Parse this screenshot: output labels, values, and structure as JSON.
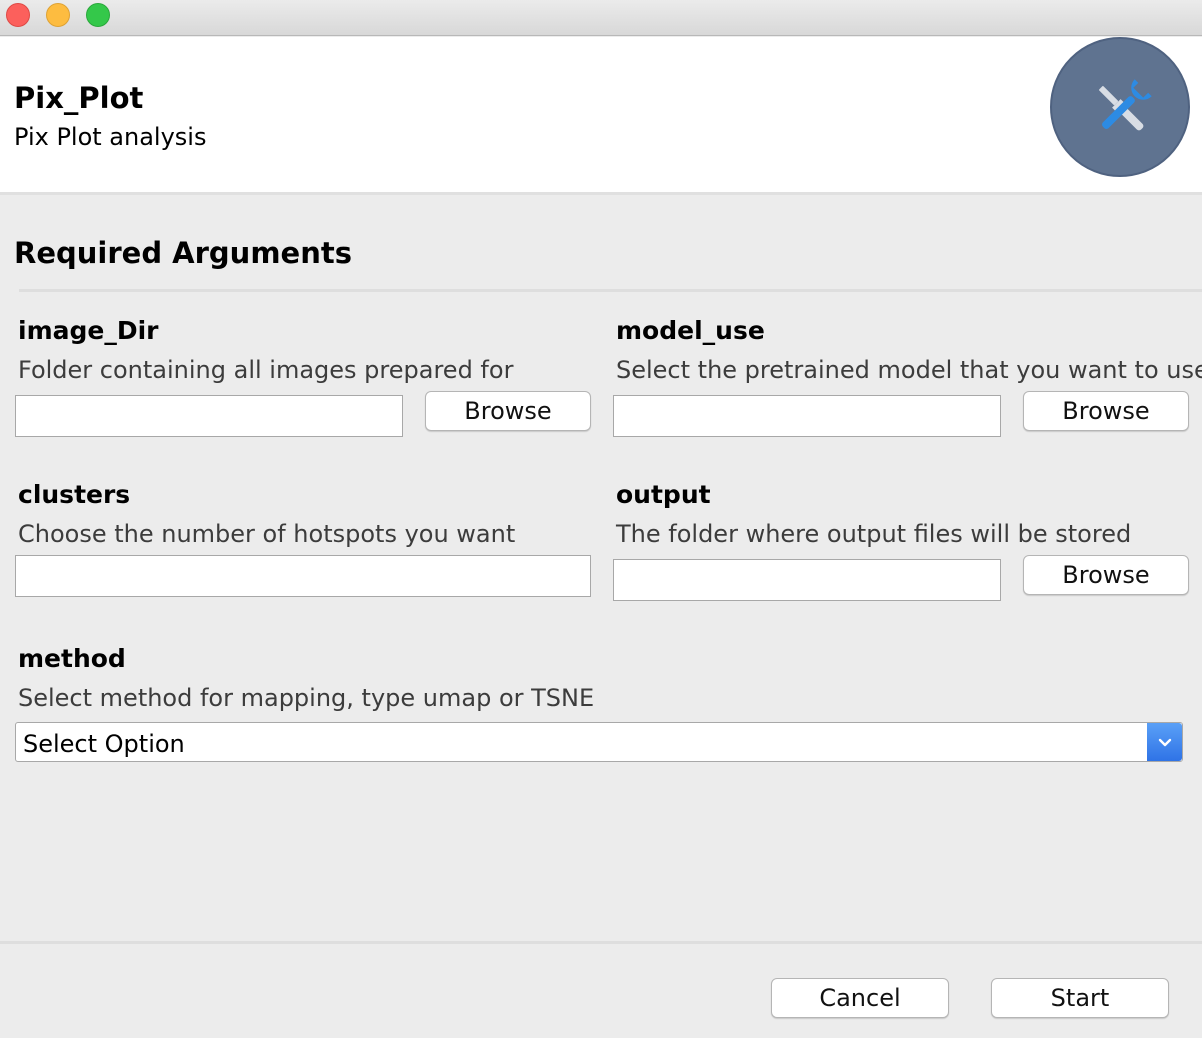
{
  "window": {
    "traffic_lights": [
      "close",
      "minimize",
      "zoom"
    ]
  },
  "header": {
    "title": "Pix_Plot",
    "subtitle": "Pix Plot analysis",
    "icon": "tools-icon",
    "icon_bg": "#5f7390"
  },
  "section": {
    "title": "Required Arguments"
  },
  "fields": {
    "image_dir": {
      "label": "image_Dir",
      "description": "Folder containing all images prepared for",
      "value": "",
      "button": "Browse"
    },
    "model_use": {
      "label": "model_use",
      "description": "Select the pretrained model that you want to use.",
      "value": "",
      "button": "Browse"
    },
    "clusters": {
      "label": "clusters",
      "description": "Choose the number of hotspots you want",
      "value": ""
    },
    "output": {
      "label": "output",
      "description": "The folder where output files will be stored",
      "value": "",
      "button": "Browse"
    },
    "method": {
      "label": "method",
      "description": "Select method for mapping, type umap or TSNE",
      "selected": "Select Option"
    }
  },
  "footer": {
    "cancel": "Cancel",
    "start": "Start"
  },
  "colors": {
    "accent": "#2f73e6",
    "background": "#ececec"
  }
}
